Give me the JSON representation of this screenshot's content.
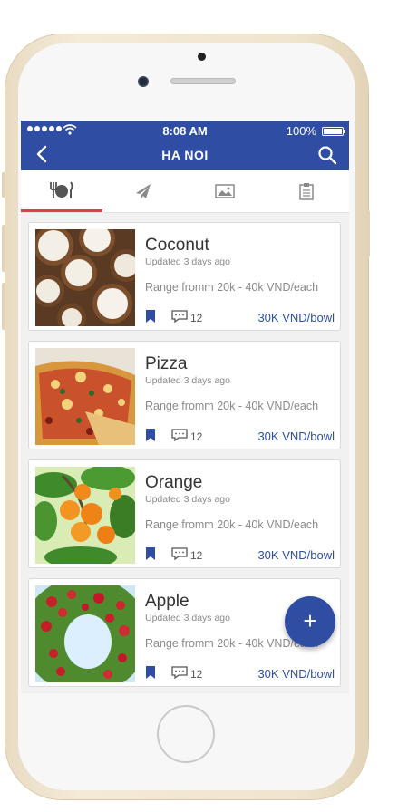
{
  "status_bar": {
    "time": "8:08 AM",
    "battery": "100%"
  },
  "header": {
    "title": "HA NOI"
  },
  "tabs": [
    {
      "icon": "restaurant-icon",
      "active": true
    },
    {
      "icon": "airplane-icon",
      "active": false
    },
    {
      "icon": "photo-icon",
      "active": false
    },
    {
      "icon": "clipboard-icon",
      "active": false
    }
  ],
  "items": [
    {
      "name": "Coconut",
      "updated": "Updated 3 days ago",
      "range": "Range fromm 20k - 40k VND/each",
      "comments": "12",
      "price": "30K VND/bowl"
    },
    {
      "name": "Pizza",
      "updated": "Updated 3 days ago",
      "range": "Range fromm 20k - 40k VND/each",
      "comments": "12",
      "price": "30K VND/bowl"
    },
    {
      "name": "Orange",
      "updated": "Updated 3 days ago",
      "range": "Range fromm 20k - 40k VND/each",
      "comments": "12",
      "price": "30K VND/bowl"
    },
    {
      "name": "Apple",
      "updated": "Updated 3 days ago",
      "range": "Range fromm 20k - 40k VND/each",
      "comments": "12",
      "price": "30K VND/bowl"
    }
  ],
  "fab": {
    "label": "+"
  },
  "colors": {
    "primary": "#2f4ea3",
    "tab_indicator": "#e23a4f",
    "price": "#2f4ea3"
  }
}
